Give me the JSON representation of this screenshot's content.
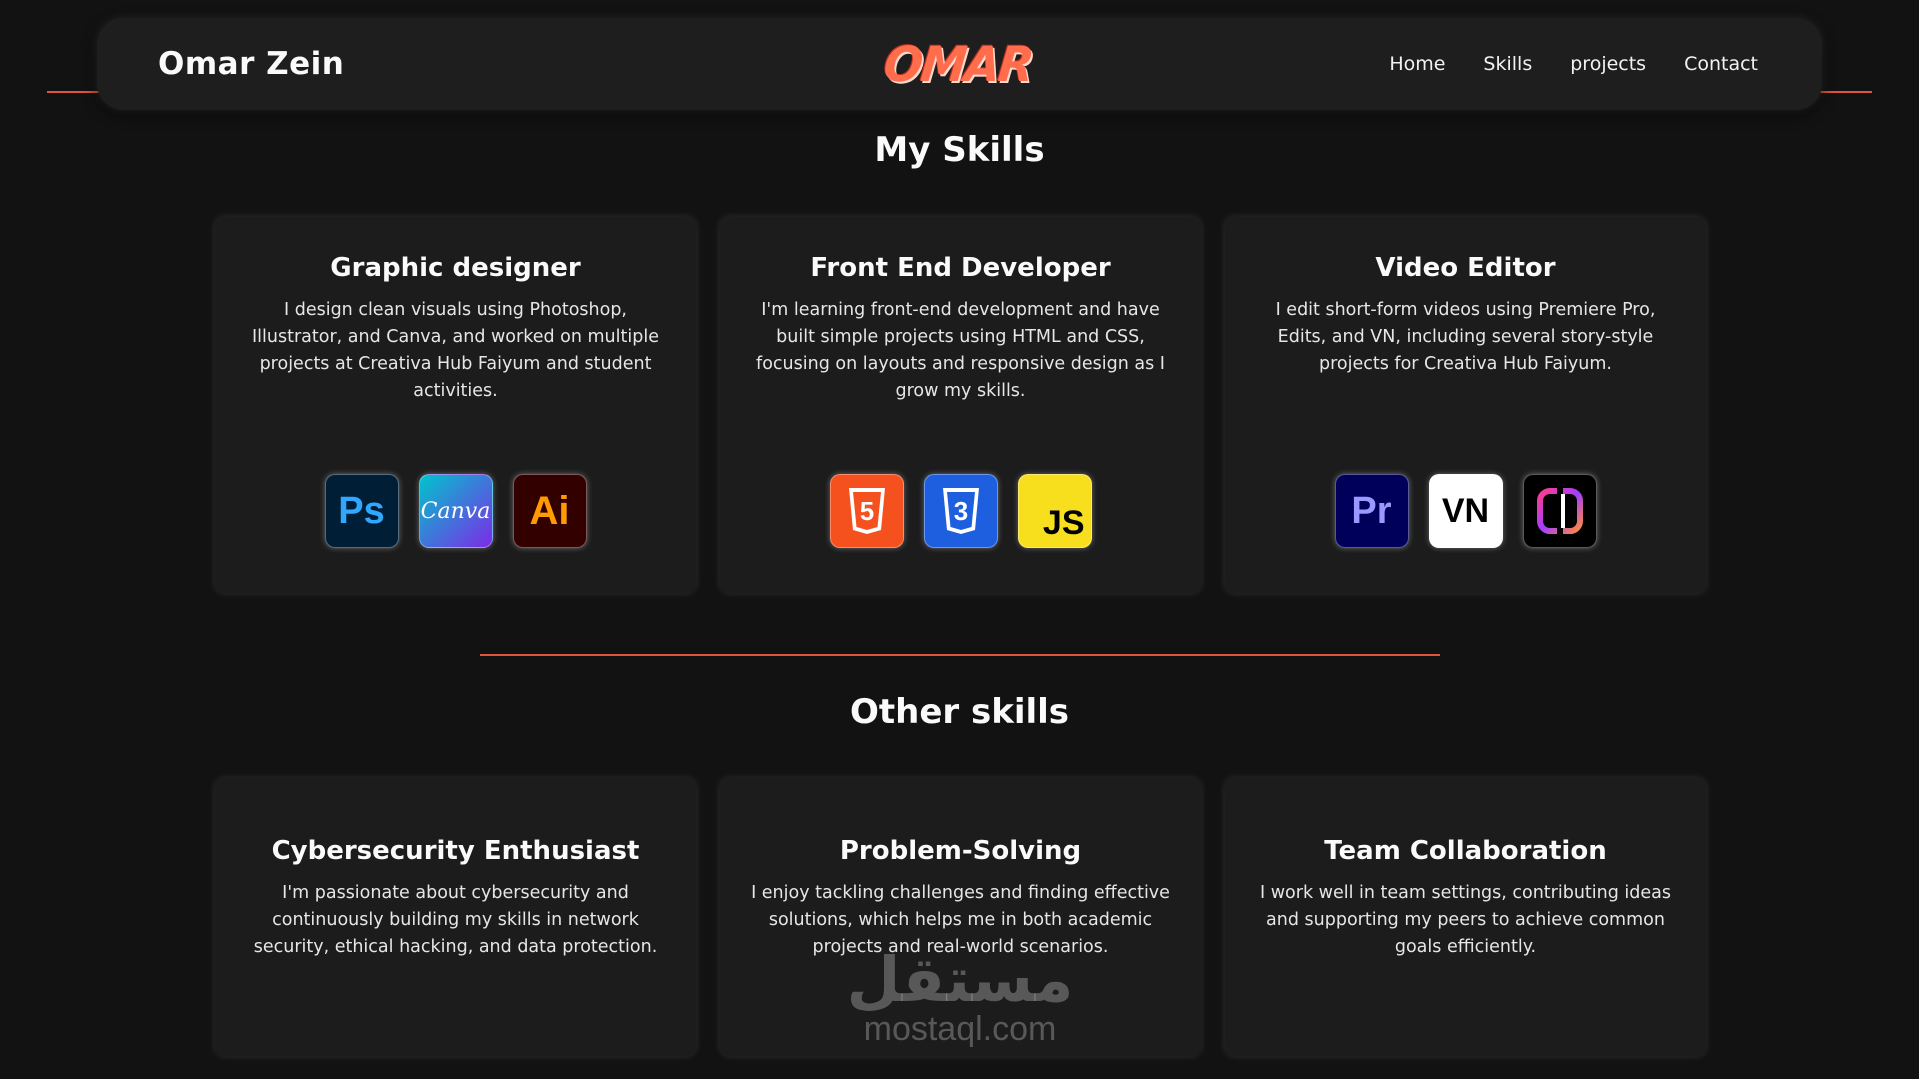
{
  "header": {
    "brand_name": "Omar Zein",
    "logo_text": "OMAR",
    "nav": [
      "Home",
      "Skills",
      "projects",
      "Contact"
    ]
  },
  "my_skills": {
    "title": "My Skills",
    "cards": [
      {
        "title": "Graphic designer",
        "desc": "I design clean visuals using Photoshop, Illustrator, and Canva, and worked on multiple projects at Creativa Hub Faiyum and student activities.",
        "icons": [
          {
            "name": "photoshop-icon",
            "label": "Ps",
            "bg": "#001e36",
            "fg": "#31a8ff"
          },
          {
            "name": "canva-icon",
            "label": "Canva",
            "bg": "#7d2ae8",
            "fg": "#ffffff"
          },
          {
            "name": "illustrator-icon",
            "label": "Ai",
            "bg": "#330000",
            "fg": "#ff9a00"
          }
        ]
      },
      {
        "title": "Front End Developer",
        "desc": "I'm learning front-end development and have built simple projects using HTML and CSS, focusing on layouts and responsive design as I grow my skills.",
        "icons": [
          {
            "name": "html5-icon",
            "label": "5",
            "bg": "#f4511e",
            "fg": "#ffffff"
          },
          {
            "name": "css3-icon",
            "label": "3",
            "bg": "#1e5fe0",
            "fg": "#ffffff"
          },
          {
            "name": "javascript-icon",
            "label": "JS",
            "bg": "#f7df1e",
            "fg": "#000000"
          }
        ]
      },
      {
        "title": "Video Editor",
        "desc": "I edit short-form videos using Premiere Pro, Edits, and VN, including several story-style projects for Creativa Hub Faiyum.",
        "icons": [
          {
            "name": "premiere-pro-icon",
            "label": "Pr",
            "bg": "#00005b",
            "fg": "#9999ff"
          },
          {
            "name": "vn-icon",
            "label": "VN",
            "bg": "#ffffff",
            "fg": "#000000"
          },
          {
            "name": "edits-icon",
            "label": "",
            "bg": "#000000",
            "fg": "#ff3d8a"
          }
        ]
      }
    ]
  },
  "other_skills": {
    "title": "Other skills",
    "cards": [
      {
        "title": "Cybersecurity Enthusiast",
        "desc": "I'm passionate about cybersecurity and continuously building my skills in network security, ethical hacking, and data protection."
      },
      {
        "title": "Problem-Solving",
        "desc": "I enjoy tackling challenges and finding effective solutions, which helps me in both academic projects and real-world scenarios."
      },
      {
        "title": "Team Collaboration",
        "desc": "I work well in team settings, contributing ideas and supporting my peers to achieve common goals efficiently."
      }
    ]
  },
  "watermark": {
    "arabic": "مستقل",
    "latin": "mostaql.com"
  },
  "colors": {
    "accent": "#e0543c",
    "background": "#121212",
    "card": "#1c1c1c"
  }
}
